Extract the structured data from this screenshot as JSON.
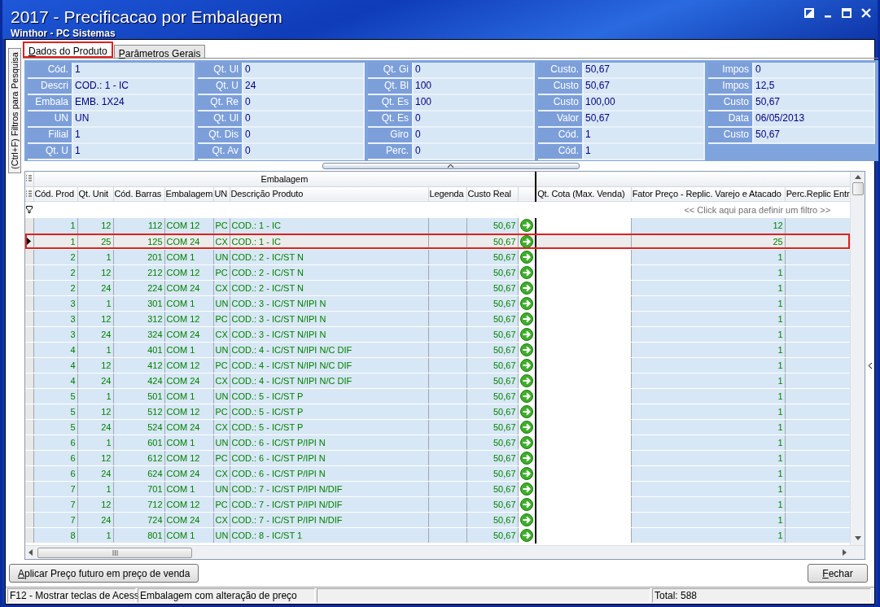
{
  "window": {
    "title": "2017 - Precificacao por Embalagem",
    "subtitle": "Winthor - PC Sistemas"
  },
  "side_tab": {
    "label": "(Ctrl+F) Filtros para Pesquisa"
  },
  "tabs": [
    {
      "label": "Dados do Produto",
      "selected": true
    },
    {
      "label": "Parâmetros Gerais",
      "selected": false
    }
  ],
  "info_panel": {
    "columns": [
      [
        {
          "label": "Cód.",
          "value": "1"
        },
        {
          "label": "Descri",
          "value": "COD.: 1 - IC"
        },
        {
          "label": "Embala",
          "value": "EMB. 1X24"
        },
        {
          "label": "UN",
          "value": "UN"
        },
        {
          "label": "Filial",
          "value": "1"
        },
        {
          "label": "Qt. U",
          "value": "1"
        }
      ],
      [
        {
          "label": "Qt. Ul",
          "value": "0"
        },
        {
          "label": "Qt. U",
          "value": "24"
        },
        {
          "label": "Qt. Re",
          "value": "0"
        },
        {
          "label": "Qt. Ul",
          "value": "0"
        },
        {
          "label": "Qt. Dis",
          "value": "0"
        },
        {
          "label": "Qt. Av",
          "value": "0"
        }
      ],
      [
        {
          "label": "Qt. Gi",
          "value": "0"
        },
        {
          "label": "Qt. Bl",
          "value": "100"
        },
        {
          "label": "Qt. Es",
          "value": "100"
        },
        {
          "label": "Qt. Es",
          "value": "0"
        },
        {
          "label": "Giro",
          "value": "0"
        },
        {
          "label": "Perc.",
          "value": "0"
        }
      ],
      [
        {
          "label": "Custo.",
          "value": "50,67"
        },
        {
          "label": "Custo",
          "value": "50,67"
        },
        {
          "label": "Custo",
          "value": "100,00"
        },
        {
          "label": "Valor",
          "value": "50,67"
        },
        {
          "label": "Cód.",
          "value": "1"
        },
        {
          "label": "Cód.",
          "value": "1"
        }
      ],
      [
        {
          "label": "Impos",
          "value": "0"
        },
        {
          "label": "Impos",
          "value": "12,5"
        },
        {
          "label": "Custo",
          "value": "50,67"
        },
        {
          "label": "Data",
          "value": "06/05/2013"
        },
        {
          "label": "Custo",
          "value": "50,67"
        }
      ]
    ]
  },
  "table": {
    "group_header": "Embalagem",
    "columns": [
      "Cód. Prod",
      "Qt. Unit",
      "Cód. Barras",
      "Embalagem",
      "UN",
      "Descrição Produto",
      "Legenda",
      "Custo Real",
      "Qt. Cota (Max. Venda)",
      "Fator Preço - Replic. Varejo e Atacado",
      "Perc.Replic Entr"
    ],
    "filter_hint": "<< Click aqui para definir um filtro >>",
    "rows": [
      {
        "cod_prod": "1",
        "qt_unit": "12",
        "cod_barras": "112",
        "embalagem": "COM 12",
        "un": "PC",
        "descricao": "COD.: 1 - IC",
        "custo_real": "50,67",
        "fator_preco": "12",
        "selected": false
      },
      {
        "cod_prod": "1",
        "qt_unit": "25",
        "cod_barras": "125",
        "embalagem": "COM 24",
        "un": "CX",
        "descricao": "COD.: 1 - IC",
        "custo_real": "50,67",
        "fator_preco": "25",
        "selected": true
      },
      {
        "cod_prod": "2",
        "qt_unit": "1",
        "cod_barras": "201",
        "embalagem": "COM 1",
        "un": "UN",
        "descricao": "COD.: 2 - IC/ST N",
        "custo_real": "50,67",
        "fator_preco": "1",
        "selected": false
      },
      {
        "cod_prod": "2",
        "qt_unit": "12",
        "cod_barras": "212",
        "embalagem": "COM 12",
        "un": "PC",
        "descricao": "COD.: 2 - IC/ST N",
        "custo_real": "50,67",
        "fator_preco": "1",
        "selected": false
      },
      {
        "cod_prod": "2",
        "qt_unit": "24",
        "cod_barras": "224",
        "embalagem": "COM 24",
        "un": "CX",
        "descricao": "COD.: 2 - IC/ST N",
        "custo_real": "50,67",
        "fator_preco": "1",
        "selected": false
      },
      {
        "cod_prod": "3",
        "qt_unit": "1",
        "cod_barras": "301",
        "embalagem": "COM 1",
        "un": "UN",
        "descricao": "COD.: 3 - IC/ST N/IPI N",
        "custo_real": "50,67",
        "fator_preco": "1",
        "selected": false
      },
      {
        "cod_prod": "3",
        "qt_unit": "12",
        "cod_barras": "312",
        "embalagem": "COM 12",
        "un": "PC",
        "descricao": "COD.: 3 - IC/ST N/IPI N",
        "custo_real": "50,67",
        "fator_preco": "1",
        "selected": false
      },
      {
        "cod_prod": "3",
        "qt_unit": "24",
        "cod_barras": "324",
        "embalagem": "COM 24",
        "un": "CX",
        "descricao": "COD.: 3 - IC/ST N/IPI N",
        "custo_real": "50,67",
        "fator_preco": "1",
        "selected": false
      },
      {
        "cod_prod": "4",
        "qt_unit": "1",
        "cod_barras": "401",
        "embalagem": "COM 1",
        "un": "UN",
        "descricao": "COD.: 4 - IC/ST N/IPI N/C DIF",
        "custo_real": "50,67",
        "fator_preco": "1",
        "selected": false
      },
      {
        "cod_prod": "4",
        "qt_unit": "12",
        "cod_barras": "412",
        "embalagem": "COM 12",
        "un": "PC",
        "descricao": "COD.: 4 - IC/ST N/IPI N/C DIF",
        "custo_real": "50,67",
        "fator_preco": "1",
        "selected": false
      },
      {
        "cod_prod": "4",
        "qt_unit": "24",
        "cod_barras": "424",
        "embalagem": "COM 24",
        "un": "CX",
        "descricao": "COD.: 4 - IC/ST N/IPI N/C DIF",
        "custo_real": "50,67",
        "fator_preco": "1",
        "selected": false
      },
      {
        "cod_prod": "5",
        "qt_unit": "1",
        "cod_barras": "501",
        "embalagem": "COM 1",
        "un": "UN",
        "descricao": "COD.: 5 - IC/ST P",
        "custo_real": "50,67",
        "fator_preco": "1",
        "selected": false
      },
      {
        "cod_prod": "5",
        "qt_unit": "12",
        "cod_barras": "512",
        "embalagem": "COM 12",
        "un": "PC",
        "descricao": "COD.: 5 - IC/ST P",
        "custo_real": "50,67",
        "fator_preco": "1",
        "selected": false
      },
      {
        "cod_prod": "5",
        "qt_unit": "24",
        "cod_barras": "524",
        "embalagem": "COM 24",
        "un": "CX",
        "descricao": "COD.: 5 - IC/ST P",
        "custo_real": "50,67",
        "fator_preco": "1",
        "selected": false
      },
      {
        "cod_prod": "6",
        "qt_unit": "1",
        "cod_barras": "601",
        "embalagem": "COM 1",
        "un": "UN",
        "descricao": "COD.: 6 - IC/ST P/IPI N",
        "custo_real": "50,67",
        "fator_preco": "1",
        "selected": false
      },
      {
        "cod_prod": "6",
        "qt_unit": "12",
        "cod_barras": "612",
        "embalagem": "COM 12",
        "un": "PC",
        "descricao": "COD.: 6 - IC/ST P/IPI N",
        "custo_real": "50,67",
        "fator_preco": "1",
        "selected": false
      },
      {
        "cod_prod": "6",
        "qt_unit": "24",
        "cod_barras": "624",
        "embalagem": "COM 24",
        "un": "CX",
        "descricao": "COD.: 6 - IC/ST P/IPI N",
        "custo_real": "50,67",
        "fator_preco": "1",
        "selected": false
      },
      {
        "cod_prod": "7",
        "qt_unit": "1",
        "cod_barras": "701",
        "embalagem": "COM 1",
        "un": "UN",
        "descricao": "COD.: 7 - IC/ST P/IPI N/DIF",
        "custo_real": "50,67",
        "fator_preco": "1",
        "selected": false
      },
      {
        "cod_prod": "7",
        "qt_unit": "12",
        "cod_barras": "712",
        "embalagem": "COM 12",
        "un": "PC",
        "descricao": "COD.: 7 - IC/ST P/IPI N/DIF",
        "custo_real": "50,67",
        "fator_preco": "1",
        "selected": false
      },
      {
        "cod_prod": "7",
        "qt_unit": "24",
        "cod_barras": "724",
        "embalagem": "COM 24",
        "un": "CX",
        "descricao": "COD.: 7 - IC/ST P/IPI N/DIF",
        "custo_real": "50,67",
        "fator_preco": "1",
        "selected": false
      },
      {
        "cod_prod": "8",
        "qt_unit": "1",
        "cod_barras": "801",
        "embalagem": "COM 1",
        "un": "UN",
        "descricao": "COD.: 8 - IC/ST 1",
        "custo_real": "50,67",
        "fator_preco": "1",
        "selected": false
      }
    ]
  },
  "buttons": [
    "Aplicar Preço futuro em preço de venda",
    "Fechar"
  ],
  "status_bar": [
    "F12 - Mostrar teclas de Acess",
    "Embalagem com alteração de preço",
    "Total: 588"
  ]
}
